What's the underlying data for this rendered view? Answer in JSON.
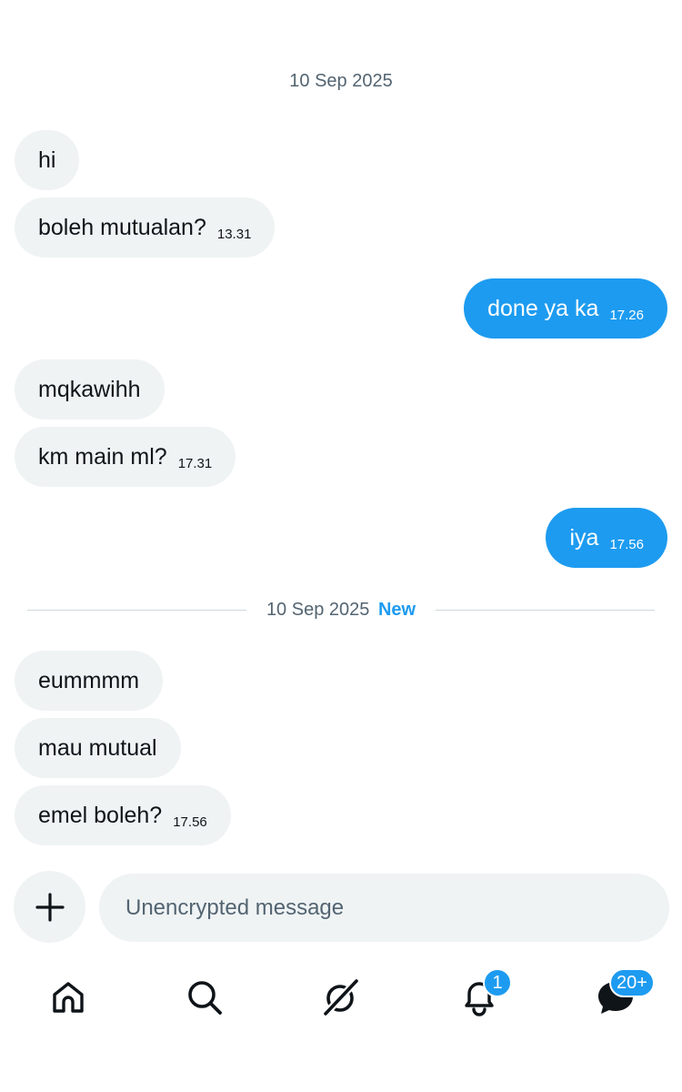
{
  "conversation": {
    "date_top": "10 Sep 2025",
    "messages_before": [
      {
        "side": "in",
        "text": "hi",
        "time": ""
      },
      {
        "side": "in",
        "text": "boleh mutualan?",
        "time": "13.31"
      },
      {
        "side": "out",
        "text": "done ya ka",
        "time": "17.26"
      },
      {
        "side": "in",
        "text": "mqkawihh",
        "time": ""
      },
      {
        "side": "in",
        "text": "km main ml?",
        "time": "17.31"
      },
      {
        "side": "out",
        "text": "iya",
        "time": "17.56"
      }
    ],
    "divider": {
      "date": "10 Sep 2025",
      "new_label": "New"
    },
    "messages_after": [
      {
        "side": "in",
        "text": "eummmm",
        "time": ""
      },
      {
        "side": "in",
        "text": "mau mutual",
        "time": ""
      },
      {
        "side": "in",
        "text": "emel boleh?",
        "time": "17.56"
      }
    ]
  },
  "composer": {
    "placeholder": "Unencrypted message",
    "value": "",
    "add_icon": "plus-icon"
  },
  "bottom_nav": {
    "items": [
      {
        "name": "home",
        "icon": "home-icon",
        "badge": ""
      },
      {
        "name": "search",
        "icon": "search-icon",
        "badge": ""
      },
      {
        "name": "grok",
        "icon": "grok-icon",
        "badge": ""
      },
      {
        "name": "notifications",
        "icon": "bell-icon",
        "badge": "1"
      },
      {
        "name": "messages",
        "icon": "messages-icon",
        "badge": "20+"
      }
    ]
  },
  "colors": {
    "accent": "#1d9bf0",
    "incoming_bubble": "#eff3f4",
    "secondary_text": "#536471"
  }
}
